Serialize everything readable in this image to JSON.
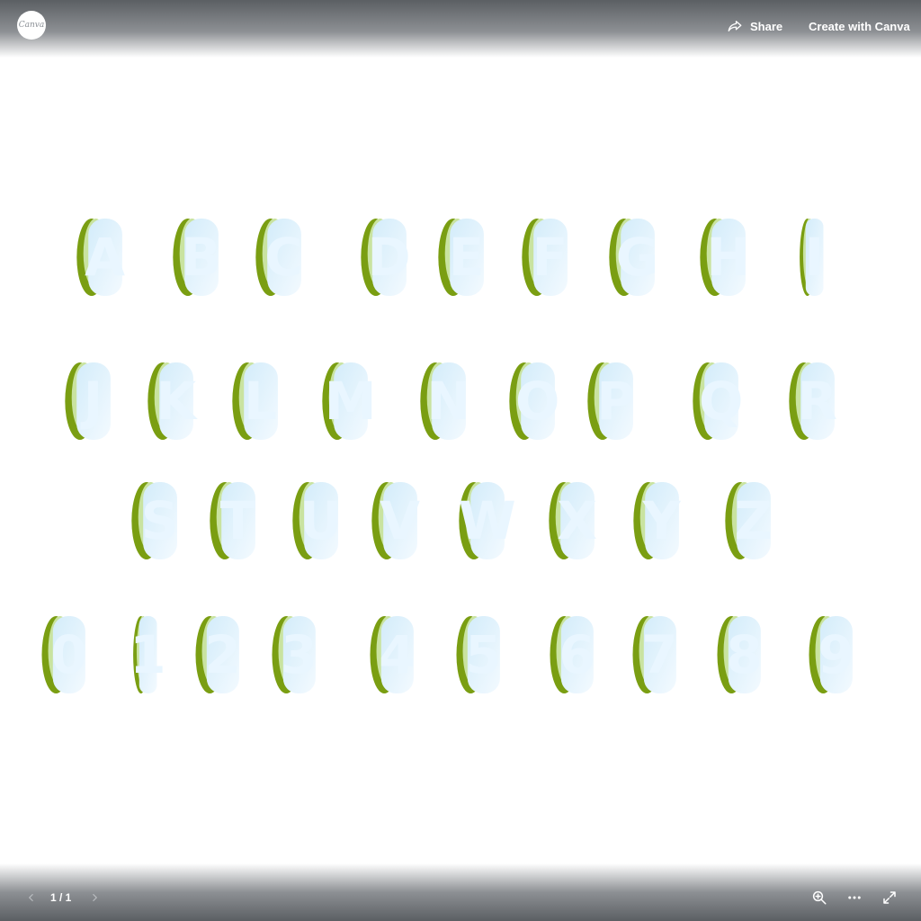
{
  "header": {
    "logo_text": "Canva",
    "share_label": "Share",
    "create_label": "Create with Canva"
  },
  "artwork": {
    "rows": [
      [
        "A",
        "B",
        "C",
        "D",
        "E",
        "F",
        "G",
        "H",
        "I"
      ],
      [
        "J",
        "K",
        "L",
        "M",
        "N",
        "O",
        "P",
        "Q",
        "R"
      ],
      [
        "S",
        "T",
        "U",
        "V",
        "W",
        "X",
        "Y",
        "Z"
      ],
      [
        "0",
        "1",
        "2",
        "3",
        "4",
        "5",
        "6",
        "7",
        "8",
        "9"
      ]
    ],
    "colors": {
      "fill_light": "#e9f6ff",
      "fill_mid": "#d3ecfa",
      "shadow": "#7a9e12",
      "highlight": "#c9e3a0"
    }
  },
  "footer": {
    "page_indicator": "1 / 1",
    "prev_icon": "chevron-left-icon",
    "next_icon": "chevron-right-icon",
    "zoom_icon": "zoom-in-icon",
    "more_icon": "more-options-icon",
    "fullscreen_icon": "fullscreen-icon"
  }
}
